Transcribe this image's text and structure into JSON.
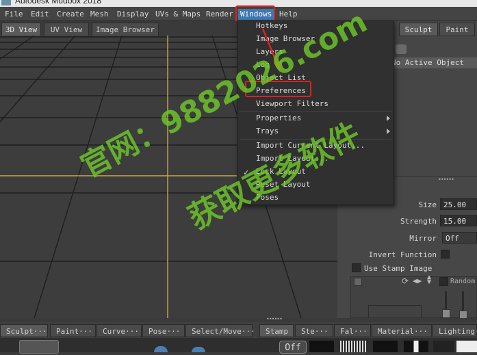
{
  "title_bar": {
    "text": "Autodesk Mudbox 2018"
  },
  "menubar": [
    "File",
    "Edit",
    "Create",
    "Mesh",
    "Display",
    "UVs & Maps",
    "Render",
    "Windows",
    "Help"
  ],
  "view_tabs": [
    "3D View",
    "UV View",
    "Image Browser"
  ],
  "windows_menu": {
    "items": [
      "Hotkeys",
      "Image Browser",
      "Layers",
      "Log",
      "Object List",
      "Preferences",
      "Viewport Filters",
      "Properties",
      "Trays",
      "Import Current Layout...",
      "Import Layout...",
      "Lock Layout",
      "Reset Layout",
      "Poses"
    ],
    "checked": "Lock Layout",
    "submenu_items": [
      "Properties",
      "Trays"
    ]
  },
  "right_panel": {
    "mode_buttons": [
      "Sculpt",
      "Paint"
    ],
    "active_object": "No Active Object",
    "properties": {
      "size_label": "Size",
      "size_value": "25.00",
      "strength_label": "Strength",
      "strength_value": "15.00",
      "mirror_label": "Mirror",
      "mirror_value": "Off",
      "invert_label": "Invert Function",
      "stamp_label": "Use Stamp Image",
      "random_label": "Random"
    }
  },
  "shelf": {
    "left_tabs": [
      "Sculpt···",
      "Paint···",
      "Curve···",
      "Pose···",
      "Select/Move···"
    ],
    "right_tabs": [
      "Stamp",
      "Ste···",
      "Fal···",
      "Material···",
      "Lighting···"
    ],
    "off_label": "Off"
  },
  "watermark": {
    "line1": "官网：9882026.com",
    "line2": "获取更多软件"
  },
  "colors": {
    "highlight": "#3e78b5",
    "annotation": "#e02020",
    "watermark": "#6ec828",
    "grid_axis": "#c8a850"
  }
}
